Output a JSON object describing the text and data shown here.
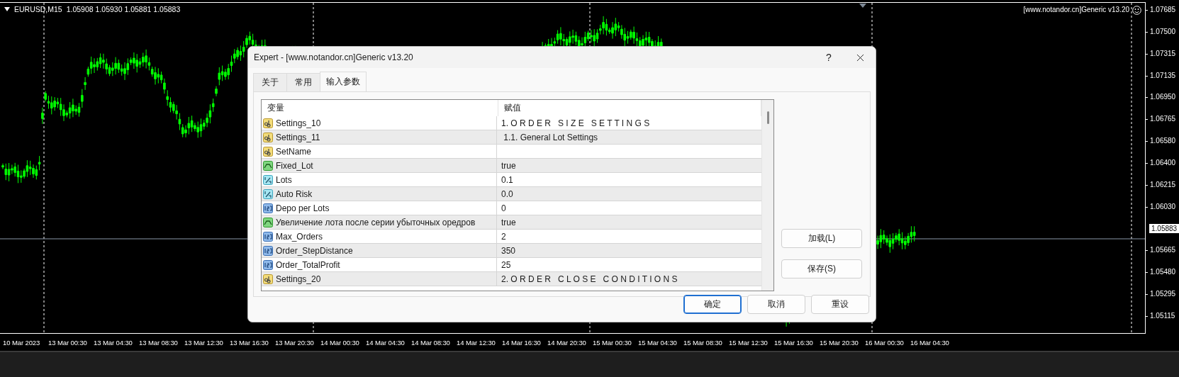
{
  "chart": {
    "header": {
      "symbol": "EURUSD,M15",
      "ohlc": "1.05908 1.05930 1.05881 1.05883"
    },
    "indicator_label": "[www.notandor.cn]Generic v13.20",
    "price_axis": {
      "upper_labels": [
        "1.07685",
        "1.07500",
        "1.07315",
        "1.07135",
        "1.06950",
        "1.06765",
        "1.06580",
        "1.06400",
        "1.06215",
        "1.06030"
      ],
      "current_price": "1.05883",
      "lower_labels": [
        "1.05665",
        "1.05480",
        "1.05295",
        "1.05115"
      ]
    },
    "time_axis": [
      "10 Mar 2023",
      "13 Mar 00:30",
      "13 Mar 04:30",
      "13 Mar 08:30",
      "13 Mar 12:30",
      "13 Mar 16:30",
      "13 Mar 20:30",
      "14 Mar 00:30",
      "14 Mar 04:30",
      "14 Mar 08:30",
      "14 Mar 12:30",
      "14 Mar 16:30",
      "14 Mar 20:30",
      "15 Mar 00:30",
      "15 Mar 04:30",
      "15 Mar 08:30",
      "15 Mar 12:30",
      "15 Mar 16:30",
      "15 Mar 20:30",
      "16 Mar 00:30",
      "16 Mar 04:30"
    ]
  },
  "dialog": {
    "title": "Expert - [www.notandor.cn]Generic v13.20",
    "help_button": "?",
    "tabs": [
      {
        "label": "关于",
        "selected": false
      },
      {
        "label": "常用",
        "selected": false
      },
      {
        "label": "输入参数",
        "selected": true
      }
    ],
    "table": {
      "columns": [
        "变量",
        "赋值"
      ],
      "rows": [
        {
          "kind": "string",
          "name": "Settings_10",
          "value": "1. O R D E R   S I Z E   S E T T I N G S"
        },
        {
          "kind": "string",
          "name": "Settings_11",
          "value": " 1.1. General Lot Settings"
        },
        {
          "kind": "string",
          "name": "SetName"
        },
        {
          "kind": "bool",
          "name": "Fixed_Lot",
          "value": "true"
        },
        {
          "kind": "double",
          "name": "Lots",
          "value": "0.1"
        },
        {
          "kind": "double",
          "name": "Auto Risk",
          "value": "0.0"
        },
        {
          "kind": "int",
          "name": "Depo per Lots",
          "value": "0"
        },
        {
          "kind": "bool",
          "name": "Увеличение лота после серии убыточных оредров",
          "value": "true"
        },
        {
          "kind": "int",
          "name": "Max_Orders",
          "value": "2"
        },
        {
          "kind": "int",
          "name": "Order_StepDistance",
          "value": "350"
        },
        {
          "kind": "int",
          "name": "Order_TotalProfit",
          "value": "25"
        },
        {
          "kind": "string",
          "name": "Settings_20",
          "value": "2. O R D E R   C L O S E   C O N D I T I O N S"
        }
      ]
    },
    "side_buttons": [
      "加载(L)",
      "保存(S)"
    ],
    "footer_buttons": [
      {
        "label": "确定",
        "default": true
      },
      {
        "label": "取消",
        "default": false
      },
      {
        "label": "重设",
        "default": false
      }
    ]
  }
}
